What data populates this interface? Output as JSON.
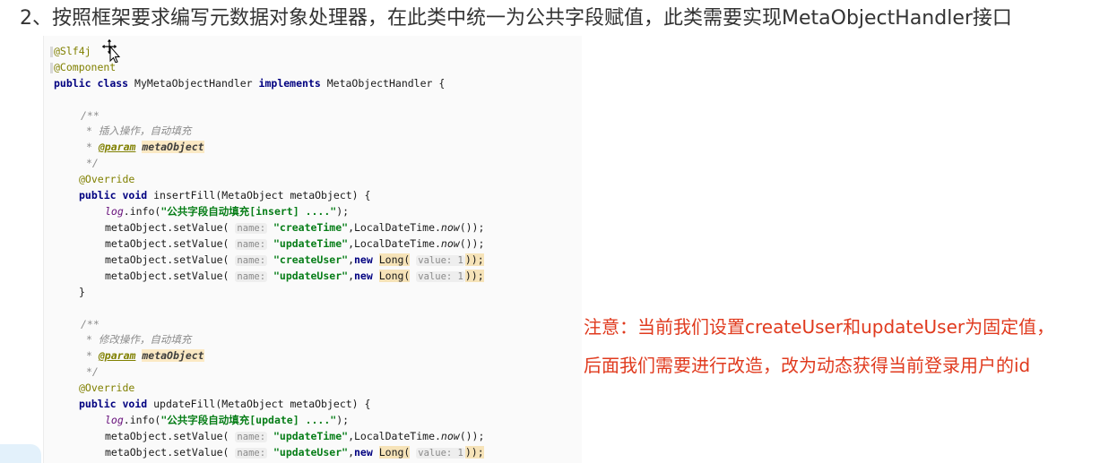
{
  "heading": "2、按照框架要求编写元数据对象处理器，在此类中统一为公共字段赋值，此类需要实现MetaObjectHandler接口",
  "note": {
    "line1": "注意：当前我们设置createUser和updateUser为固定值，",
    "line2": "后面我们需要进行改造，改为动态获得当前登录用户的id"
  },
  "code": {
    "ann_slf4j": "@Slf4j",
    "ann_component": "@Component",
    "kw_public": "public",
    "kw_class": "class",
    "class_name": "MyMetaObjectHandler",
    "kw_implements": "implements",
    "interface_name": "MetaObjectHandler {",
    "doc_open": "/**",
    "doc_insert_text": "* 插入操作，自动填充",
    "doc_star": "*",
    "doc_param_tag": "@param",
    "doc_param_name": "metaObject",
    "doc_close": "*/",
    "ann_override": "@Override",
    "kw_void": "void",
    "insert_sig": "insertFill(MetaObject metaObject) {",
    "update_sig": "updateFill(MetaObject metaObject) {",
    "log_field": "log",
    "info_call": ".info(",
    "log_insert_str": "\"公共字段自动填充[insert] ....\"",
    "log_update_str": "\"公共字段自动填充[update] ....\"",
    "call_end": ");",
    "set_value": "metaObject.setValue(",
    "hint_name": "name:",
    "hint_value": "value: 1",
    "str_createTime": "\"createTime\"",
    "str_updateTime": "\"updateTime\"",
    "str_createUser": "\"createUser\"",
    "str_updateUser": "\"updateUser\"",
    "now_prefix": ",LocalDateTime.",
    "now_method": "now",
    "now_suffix": "());",
    "comma": ",",
    "kw_new": "new",
    "long_open": "Long(",
    "long_close": "));",
    "brace_close": "}",
    "doc_update_text": "* 修改操作，自动填充"
  }
}
